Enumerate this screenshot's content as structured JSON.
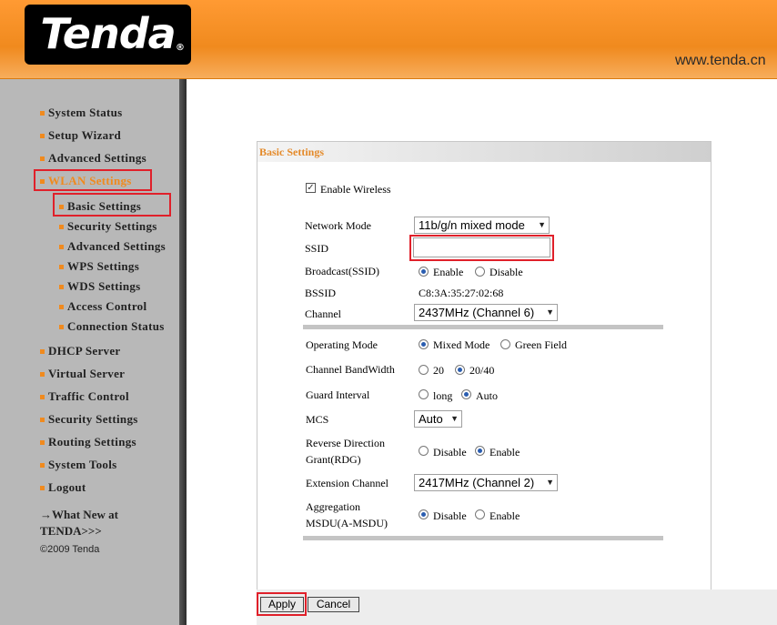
{
  "header": {
    "logo_text": "Tenda",
    "logo_mark": "®",
    "url": "www.tenda.cn"
  },
  "sidebar": {
    "items": [
      {
        "label": "System Status"
      },
      {
        "label": "Setup Wizard"
      },
      {
        "label": "Advanced Settings"
      },
      {
        "label": "WLAN Settings"
      },
      {
        "label": "Basic Settings"
      },
      {
        "label": "Security Settings"
      },
      {
        "label": "Advanced Settings"
      },
      {
        "label": "WPS Settings"
      },
      {
        "label": "WDS Settings"
      },
      {
        "label": "Access Control"
      },
      {
        "label": "Connection Status"
      },
      {
        "label": "DHCP Server"
      },
      {
        "label": "Virtual Server"
      },
      {
        "label": "Traffic Control"
      },
      {
        "label": "Security Settings"
      },
      {
        "label": "Routing Settings"
      },
      {
        "label": "System Tools"
      },
      {
        "label": "Logout"
      }
    ],
    "whatnew_line1": "→What New at",
    "whatnew_line2": "TENDA>>>",
    "copyright": "©2009 Tenda"
  },
  "panel": {
    "title": "Basic Settings",
    "enable_wireless": {
      "label": "Enable Wireless",
      "checked": true
    },
    "network_mode": {
      "label": "Network Mode",
      "value": "11b/g/n mixed mode"
    },
    "ssid": {
      "label": "SSID",
      "value": ""
    },
    "broadcast": {
      "label": "Broadcast(SSID)",
      "options": [
        "Enable",
        "Disable"
      ],
      "selected": "Enable"
    },
    "bssid": {
      "label": "BSSID",
      "value": "C8:3A:35:27:02:68"
    },
    "channel": {
      "label": "Channel",
      "value": "2437MHz (Channel 6)"
    },
    "operating_mode": {
      "label": "Operating Mode",
      "options": [
        "Mixed Mode",
        "Green Field"
      ],
      "selected": "Mixed Mode"
    },
    "bandwidth": {
      "label": "Channel BandWidth",
      "options": [
        "20",
        "20/40"
      ],
      "selected": "20/40"
    },
    "guard_interval": {
      "label": "Guard Interval",
      "options": [
        "long",
        "Auto"
      ],
      "selected": "Auto"
    },
    "mcs": {
      "label": "MCS",
      "value": "Auto"
    },
    "rdg": {
      "label_line1": "Reverse Direction",
      "label_line2": "Grant(RDG)",
      "options": [
        "Disable",
        "Enable"
      ],
      "selected": "Enable"
    },
    "ext_channel": {
      "label": "Extension Channel",
      "value": "2417MHz (Channel 2)"
    },
    "amsdu": {
      "label_line1": "Aggregation",
      "label_line2": "MSDU(A-MSDU)",
      "options": [
        "Disable",
        "Enable"
      ],
      "selected": "Disable"
    }
  },
  "buttons": {
    "apply": "Apply",
    "cancel": "Cancel"
  },
  "colors": {
    "accent_orange": "#f08a1e",
    "highlight_red": "#e0202a",
    "title_orange": "#e48a2a"
  }
}
